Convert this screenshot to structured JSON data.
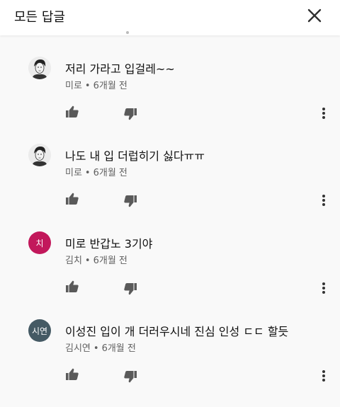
{
  "header": {
    "title": "모든 답글"
  },
  "comments": [
    {
      "avatar_type": "photo",
      "avatar_text": "",
      "text": "저리 가라고 입걸레~~",
      "author": "미로",
      "time": "6개월 전"
    },
    {
      "avatar_type": "photo",
      "avatar_text": "",
      "text": "나도 내 입 더럽히기 싫다ㅠㅠ",
      "author": "미로",
      "time": "6개월 전"
    },
    {
      "avatar_type": "initial",
      "avatar_text": "치",
      "avatar_color": "#c2185b",
      "text": "미로 반갑노 3기야",
      "author": "김치",
      "time": "6개월 전"
    },
    {
      "avatar_type": "initial",
      "avatar_text": "시연",
      "avatar_color": "#455a64",
      "text": "이성진  입이 개 더러우시네 진심 인성 ㄷㄷ 할듯",
      "author": "김시연",
      "time": "6개월 전"
    }
  ],
  "separator": "•",
  "icons": {
    "close": "close-icon",
    "like": "thumb-up-icon",
    "dislike": "thumb-down-icon",
    "more": "more-vert-icon"
  }
}
